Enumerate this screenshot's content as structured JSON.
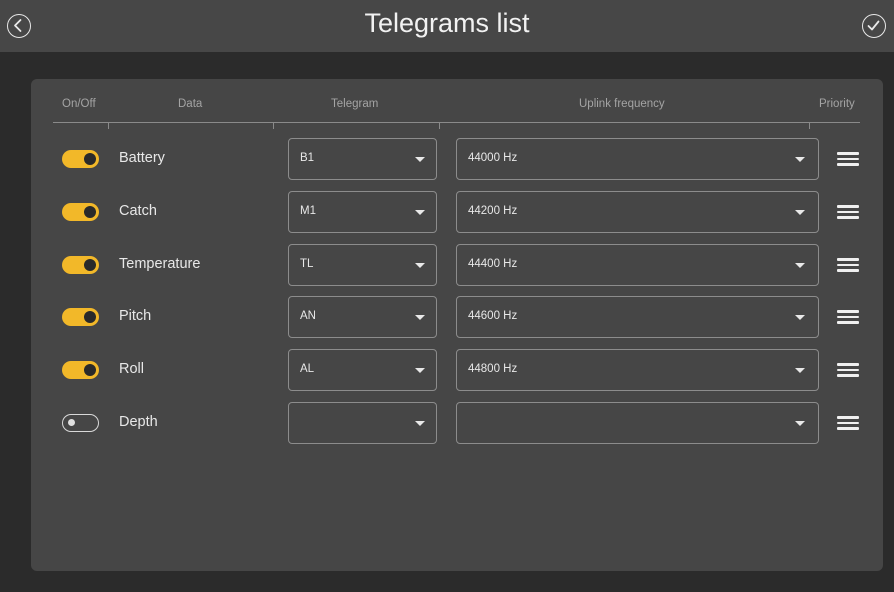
{
  "window": {
    "title": "Telegrams list",
    "back_icon": "chevron-left-circle-icon",
    "confirm_icon": "check-circle-icon"
  },
  "table": {
    "headers": {
      "on_off": "On/Off",
      "data": "Data",
      "telegram": "Telegram",
      "uplink_frequency": "Uplink frequency",
      "priority": "Priority"
    },
    "rows": [
      {
        "enabled": true,
        "data": "Battery",
        "telegram": "B1",
        "frequency": "44000 Hz"
      },
      {
        "enabled": true,
        "data": "Catch",
        "telegram": "M1",
        "frequency": "44200 Hz"
      },
      {
        "enabled": true,
        "data": "Temperature",
        "telegram": "TL",
        "frequency": "44400 Hz"
      },
      {
        "enabled": true,
        "data": "Pitch",
        "telegram": "AN",
        "frequency": "44600 Hz"
      },
      {
        "enabled": true,
        "data": "Roll",
        "telegram": "AL",
        "frequency": "44800 Hz"
      },
      {
        "enabled": false,
        "data": "Depth",
        "telegram": "",
        "frequency": ""
      }
    ]
  },
  "colors": {
    "accent": "#f2b829",
    "background": "#2b2b2b",
    "topbar": "#474747",
    "panel": "#464646"
  }
}
